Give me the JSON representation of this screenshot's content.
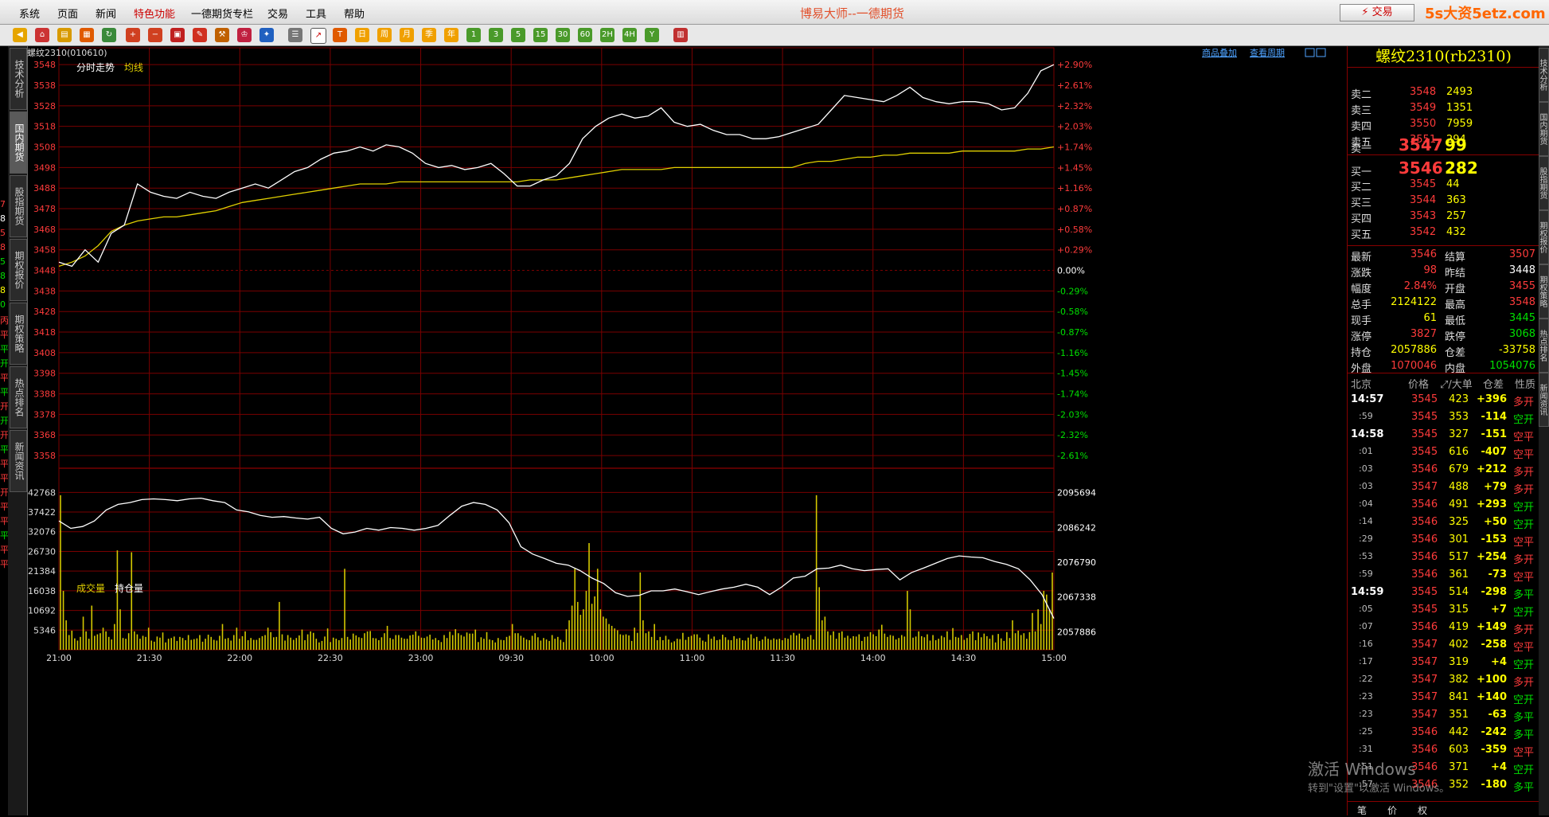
{
  "menu": [
    "系统",
    "页面",
    "新闻",
    "特色功能",
    "一德期货专栏",
    "交易",
    "工具",
    "帮助"
  ],
  "app_title": "博易大师--一德期货",
  "trade_button": "⚡ 交易",
  "site_logo": "5s大资5etz.com",
  "toolbar": {
    "period_buttons": [
      "日",
      "周",
      "月",
      "季",
      "年",
      "1",
      "3",
      "5",
      "15",
      "30",
      "60",
      "2H",
      "4H",
      "Y"
    ],
    "icons": [
      "back-icon",
      "home-icon",
      "book-icon",
      "news-icon",
      "zoom-in-icon",
      "zoom-out-icon",
      "window-icon",
      "pen-icon",
      "tool-icon",
      "trophy-icon",
      "new-icon",
      "table-icon",
      "trend-icon",
      "tick-icon",
      "calendar-icon"
    ]
  },
  "left_tabs": [
    "技术分析",
    "国内期货",
    "股指期货",
    "期权报价",
    "期权策略",
    "热点排名",
    "新闻资讯"
  ],
  "left_tabs_active": 1,
  "right_tabs": [
    "技术分析",
    "国内期货",
    "股指期货",
    "期权报价",
    "期权策略",
    "热点排名",
    "新闻资讯"
  ],
  "left_edge_marks": [
    {
      "text": "7",
      "c": "red"
    },
    {
      "text": "8",
      "c": "wht"
    },
    {
      "text": "5",
      "c": "red"
    },
    {
      "text": "8",
      "c": "red"
    },
    {
      "text": "5",
      "c": "grn"
    },
    {
      "text": "8",
      "c": "grn"
    },
    {
      "text": "8",
      "c": "yel"
    },
    {
      "text": "0",
      "c": "grn"
    },
    {
      "text": "丙",
      "c": "red"
    },
    {
      "text": "平",
      "c": "red"
    },
    {
      "text": "平",
      "c": "grn"
    },
    {
      "text": "开",
      "c": "grn"
    },
    {
      "text": "平",
      "c": "red"
    },
    {
      "text": "平",
      "c": "grn"
    },
    {
      "text": "开",
      "c": "red"
    },
    {
      "text": "开",
      "c": "grn"
    },
    {
      "text": "开",
      "c": "red"
    },
    {
      "text": "平",
      "c": "grn"
    },
    {
      "text": "平",
      "c": "red"
    },
    {
      "text": "平",
      "c": "red"
    },
    {
      "text": "开",
      "c": "red"
    },
    {
      "text": "平",
      "c": "red"
    },
    {
      "text": "平",
      "c": "red"
    },
    {
      "text": "平",
      "c": "grn"
    },
    {
      "text": "平",
      "c": "red"
    },
    {
      "text": "平",
      "c": "red"
    }
  ],
  "chart_header": {
    "symbol_code": "螺纹2310(010610)",
    "tab_intraday": "分时走势",
    "tab_avg": "均线",
    "link_overlay": "商品叠加",
    "link_period": "查看周期"
  },
  "chart_data": {
    "type": "line",
    "price_axis_labels": [
      "3548",
      "3538",
      "3528",
      "3518",
      "3508",
      "3498",
      "3488",
      "3478",
      "3468",
      "3458",
      "3448",
      "3438",
      "3428",
      "3418",
      "3408",
      "3398",
      "3388",
      "3378",
      "3368",
      "3358"
    ],
    "pct_axis_labels": [
      "+2.90%",
      "+2.61%",
      "+2.32%",
      "+2.03%",
      "+1.74%",
      "+1.45%",
      "+1.16%",
      "+0.87%",
      "+0.58%",
      "+0.29%",
      "0.00%",
      "-0.29%",
      "-0.58%",
      "-0.87%",
      "-1.16%",
      "-1.45%",
      "-1.74%",
      "-2.03%",
      "-2.32%",
      "-2.61%"
    ],
    "prev_settle": 3448,
    "ylim": [
      3353,
      3550
    ],
    "x_ticks": [
      "21:00",
      "21:30",
      "22:00",
      "22:30",
      "23:00",
      "09:30",
      "10:00",
      "11:00",
      "11:30",
      "14:00",
      "14:30",
      "15:00"
    ],
    "price_series": [
      3452,
      3450,
      3458,
      3452,
      3466,
      3470,
      3490,
      3486,
      3484,
      3483,
      3486,
      3484,
      3483,
      3486,
      3488,
      3490,
      3488,
      3492,
      3496,
      3498,
      3502,
      3505,
      3506,
      3508,
      3506,
      3509,
      3508,
      3505,
      3500,
      3498,
      3499,
      3497,
      3498,
      3500,
      3495,
      3489,
      3489,
      3492,
      3494,
      3500,
      3512,
      3518,
      3522,
      3524,
      3522,
      3523,
      3527,
      3520,
      3518,
      3519,
      3516,
      3514,
      3514,
      3512,
      3512,
      3513,
      3515,
      3517,
      3519,
      3526,
      3533,
      3532,
      3531,
      3530,
      3533,
      3537,
      3532,
      3530,
      3529,
      3530,
      3530,
      3529,
      3526,
      3527,
      3534,
      3545,
      3548
    ],
    "avg_series": [
      3450,
      3452,
      3455,
      3460,
      3467,
      3470,
      3472,
      3473,
      3474,
      3474,
      3475,
      3476,
      3477,
      3479,
      3481,
      3482,
      3483,
      3484,
      3485,
      3486,
      3487,
      3488,
      3489,
      3490,
      3490,
      3490,
      3491,
      3491,
      3491,
      3491,
      3491,
      3491,
      3491,
      3491,
      3491,
      3491,
      3492,
      3492,
      3492,
      3493,
      3494,
      3495,
      3496,
      3497,
      3497,
      3497,
      3497,
      3498,
      3498,
      3498,
      3498,
      3498,
      3498,
      3498,
      3498,
      3498,
      3498,
      3500,
      3501,
      3501,
      3502,
      3503,
      3503,
      3504,
      3504,
      3505,
      3505,
      3505,
      3505,
      3506,
      3506,
      3506,
      3506,
      3506,
      3507,
      3507,
      3508
    ],
    "volume_header": {
      "vol_label": "成交量",
      "oi_label": "持仓量"
    },
    "volume_axis_labels": [
      "42768",
      "37422",
      "32076",
      "26730",
      "21384",
      "16038",
      "10692",
      "5346"
    ],
    "oi_axis_labels": [
      "2095694",
      "2086242",
      "2076790",
      "2067338",
      "2057886"
    ],
    "vol_ylim": [
      0,
      45000
    ],
    "oi_ylim": [
      2053000,
      2098000
    ],
    "volume_bars": [
      42000,
      16000,
      8000,
      4000,
      5200,
      3100,
      2500,
      3500,
      9000,
      5000,
      3000,
      12000,
      3800,
      4200,
      4500,
      6000,
      5000,
      3500,
      2800,
      7000,
      27000,
      11000,
      3200,
      3000,
      4500,
      26500,
      5000,
      4200,
      3000,
      3800,
      3500,
      6000,
      2500,
      2200,
      3600,
      3300,
      4700,
      2000,
      3000,
      3200,
      3600,
      2400,
      3500,
      3200,
      2600,
      4000,
      2700,
      2900,
      3100,
      4000,
      2200,
      3000,
      4100,
      3500,
      2700,
      2500,
      3800,
      7000,
      3000,
      3200,
      2500,
      4000,
      6000,
      3000,
      3700,
      5000,
      2600,
      3200,
      2700,
      2700,
      3200,
      3700,
      4000,
      6000,
      4800,
      3400,
      3500,
      13000,
      4200,
      2500,
      4000,
      3300,
      2700,
      3200,
      3900,
      5500,
      2600,
      4200,
      5000,
      4600,
      3000,
      2000,
      2400,
      3600,
      5800,
      2100,
      3300,
      3000,
      2600,
      3200,
      22000,
      3500,
      2800,
      4400,
      3900,
      3400,
      3200,
      4500,
      5000,
      5100,
      3200,
      3100,
      2600,
      3400,
      4500,
      6500,
      3200,
      2900,
      4000,
      4000,
      3300,
      3000,
      3000,
      3900,
      4100,
      5000,
      3800,
      3300,
      3200,
      3600,
      4100,
      2800,
      3200,
      2600,
      2100,
      4000,
      3200,
      4900,
      4000,
      5600,
      4500,
      4000,
      3600,
      4700,
      4400,
      4400,
      5500,
      2100,
      3400,
      3000,
      4800,
      2800,
      2600,
      2000,
      3200,
      2700,
      2600,
      3500,
      3800,
      7000,
      4500,
      4500,
      3800,
      3300,
      2800,
      2600,
      3800,
      4500,
      3400,
      2500,
      3200,
      2800,
      2400,
      4000,
      3000,
      3500,
      2700,
      2100,
      5600,
      8000,
      12000,
      22000,
      13000,
      9500,
      11000,
      16000,
      29000,
      12500,
      14500,
      22000,
      11000,
      9000,
      8500,
      7000,
      6500,
      5800,
      5300,
      4200,
      4000,
      4200,
      3900,
      2400,
      6000,
      4600,
      21000,
      8000,
      4500,
      5000,
      3500,
      7000,
      2600,
      3500,
      2600,
      3800,
      2800,
      2000,
      2300,
      3000,
      2900,
      4600,
      2700,
      3500,
      3800,
      4200,
      4200,
      3300,
      2500,
      2200,
      4200,
      3000,
      3600,
      2600,
      2800,
      4100,
      3400,
      2700,
      2600,
      3700,
      3000,
      3200,
      2600,
      2500,
      3300,
      4200,
      3100,
      3500,
      2400,
      2800,
      3600,
      3000,
      2700,
      3100,
      2800,
      3000,
      2600,
      3200,
      3000,
      4000,
      4600,
      3900,
      4400,
      3100,
      2900,
      3500,
      4000,
      2800,
      42000,
      17000,
      8000,
      9000,
      5000,
      4000,
      5000,
      3000,
      4600,
      5000,
      3300,
      3800,
      3100,
      3700,
      3600,
      4200,
      2400,
      3500,
      3600,
      4800,
      4200,
      3700,
      5500,
      6800,
      4400,
      3500,
      4000,
      3800,
      2800,
      3200,
      4000,
      3600,
      16000,
      11000,
      3300,
      3600,
      5000,
      3700,
      3400,
      4200,
      2500,
      4000,
      2600,
      3000,
      3800,
      3400,
      5000,
      2700,
      5900,
      3500,
      3300,
      4000,
      2700,
      3200,
      4300,
      5000,
      2600,
      4700,
      3400,
      4400,
      3700,
      3000,
      4000,
      2000,
      4300,
      3100,
      2400,
      4800,
      3200,
      8000,
      4500,
      5200,
      4000,
      4500,
      3000,
      4800,
      10000,
      5000,
      11000,
      7000,
      16000,
      15000,
      11000,
      21000
    ],
    "oi_series": [
      2088000,
      2086000,
      2086500,
      2088000,
      2091000,
      2092500,
      2093000,
      2093800,
      2094000,
      2093800,
      2093500,
      2094000,
      2094200,
      2093500,
      2093000,
      2091000,
      2090500,
      2089500,
      2089000,
      2089200,
      2088800,
      2088500,
      2089000,
      2086000,
      2084500,
      2085000,
      2086000,
      2085500,
      2086200,
      2086000,
      2085500,
      2086000,
      2086800,
      2089500,
      2092000,
      2093000,
      2092500,
      2091000,
      2087500,
      2081000,
      2079000,
      2077800,
      2076500,
      2076000,
      2074500,
      2072500,
      2071000,
      2068500,
      2067500,
      2067800,
      2069000,
      2069000,
      2069500,
      2068800,
      2068000,
      2068800,
      2069500,
      2070000,
      2070800,
      2070000,
      2068000,
      2070000,
      2072500,
      2073000,
      2075000,
      2075200,
      2076000,
      2075000,
      2074500,
      2074800,
      2075000,
      2072000,
      2074000,
      2075200,
      2076500,
      2077800,
      2078500,
      2078200,
      2078000,
      2077000,
      2076200,
      2075000,
      2072000,
      2068000,
      2061500
    ],
    "dashed_price_line": 3448
  },
  "quote": {
    "title": "螺纹2310(rb2310)",
    "asks": [
      {
        "label": "卖五",
        "price": "3551",
        "vol": "294"
      },
      {
        "label": "卖四",
        "price": "3550",
        "vol": "7959"
      },
      {
        "label": "卖三",
        "price": "3549",
        "vol": "1351"
      },
      {
        "label": "卖二",
        "price": "3548",
        "vol": "2493"
      },
      {
        "label": "卖一",
        "price": "3547",
        "vol": "99"
      }
    ],
    "bids": [
      {
        "label": "买一",
        "price": "3546",
        "vol": "282"
      },
      {
        "label": "买二",
        "price": "3545",
        "vol": "44"
      },
      {
        "label": "买三",
        "price": "3544",
        "vol": "363"
      },
      {
        "label": "买四",
        "price": "3543",
        "vol": "257"
      },
      {
        "label": "买五",
        "price": "3542",
        "vol": "432"
      }
    ],
    "stats": [
      {
        "l1": "最新",
        "v1": "3546",
        "c1": "red",
        "l2": "结算",
        "v2": "3507",
        "c2": "red"
      },
      {
        "l1": "涨跌",
        "v1": "98",
        "c1": "red",
        "l2": "昨结",
        "v2": "3448",
        "c2": "wht"
      },
      {
        "l1": "幅度",
        "v1": "2.84%",
        "c1": "red",
        "l2": "开盘",
        "v2": "3455",
        "c2": "red"
      },
      {
        "l1": "总手",
        "v1": "2124122",
        "c1": "yel",
        "l2": "最高",
        "v2": "3548",
        "c2": "red"
      },
      {
        "l1": "现手",
        "v1": "61",
        "c1": "yel",
        "l2": "最低",
        "v2": "3445",
        "c2": "grn"
      },
      {
        "l1": "涨停",
        "v1": "3827",
        "c1": "red",
        "l2": "跌停",
        "v2": "3068",
        "c2": "grn"
      },
      {
        "l1": "持仓",
        "v1": "2057886",
        "c1": "yel",
        "l2": "仓差",
        "v2": "-33758",
        "c2": "yel"
      },
      {
        "l1": "外盘",
        "v1": "1070046",
        "c1": "red",
        "l2": "内盘",
        "v2": "1054076",
        "c2": "grn"
      }
    ],
    "ticks_header": {
      "time": "北京",
      "price": "价格",
      "vol": "⤢/大单",
      "oi": "仓差",
      "nature": "性质"
    },
    "ticks": [
      {
        "t": "14:57",
        "p": "3545",
        "v": "423",
        "oi": "+396",
        "n": "多开",
        "nc": "red",
        "big": true
      },
      {
        "t": ":59",
        "p": "3545",
        "v": "353",
        "oi": "-114",
        "n": "空开",
        "nc": "grn",
        "big": false
      },
      {
        "t": "14:58",
        "p": "3545",
        "v": "327",
        "oi": "-151",
        "n": "空平",
        "nc": "red",
        "big": true
      },
      {
        "t": ":01",
        "p": "3545",
        "v": "616",
        "oi": "-407",
        "n": "空平",
        "nc": "red",
        "big": false
      },
      {
        "t": ":03",
        "p": "3546",
        "v": "679",
        "oi": "+212",
        "n": "多开",
        "nc": "red",
        "big": false
      },
      {
        "t": ":03",
        "p": "3547",
        "v": "488",
        "oi": "+79",
        "n": "多开",
        "nc": "red",
        "big": false
      },
      {
        "t": ":04",
        "p": "3546",
        "v": "491",
        "oi": "+293",
        "n": "空开",
        "nc": "grn",
        "big": false
      },
      {
        "t": ":14",
        "p": "3546",
        "v": "325",
        "oi": "+50",
        "n": "空开",
        "nc": "grn",
        "big": false
      },
      {
        "t": ":29",
        "p": "3546",
        "v": "301",
        "oi": "-153",
        "n": "空平",
        "nc": "red",
        "big": false
      },
      {
        "t": ":53",
        "p": "3546",
        "v": "517",
        "oi": "+254",
        "n": "多开",
        "nc": "red",
        "big": false
      },
      {
        "t": ":59",
        "p": "3546",
        "v": "361",
        "oi": "-73",
        "n": "空平",
        "nc": "red",
        "big": false
      },
      {
        "t": "14:59",
        "p": "3545",
        "v": "514",
        "oi": "-298",
        "n": "多平",
        "nc": "grn",
        "big": true
      },
      {
        "t": ":05",
        "p": "3545",
        "v": "315",
        "oi": "+7",
        "n": "空开",
        "nc": "grn",
        "big": false
      },
      {
        "t": ":07",
        "p": "3546",
        "v": "419",
        "oi": "+149",
        "n": "多开",
        "nc": "red",
        "big": false
      },
      {
        "t": ":16",
        "p": "3547",
        "v": "402",
        "oi": "-258",
        "n": "空平",
        "nc": "red",
        "big": false
      },
      {
        "t": ":17",
        "p": "3547",
        "v": "319",
        "oi": "+4",
        "n": "空开",
        "nc": "grn",
        "big": false
      },
      {
        "t": ":22",
        "p": "3547",
        "v": "382",
        "oi": "+100",
        "n": "多开",
        "nc": "red",
        "big": false
      },
      {
        "t": ":23",
        "p": "3547",
        "v": "841",
        "oi": "+140",
        "n": "空开",
        "nc": "grn",
        "big": false
      },
      {
        "t": ":23",
        "p": "3547",
        "v": "351",
        "oi": "-63",
        "n": "多平",
        "nc": "grn",
        "big": false
      },
      {
        "t": ":25",
        "p": "3546",
        "v": "442",
        "oi": "-242",
        "n": "多平",
        "nc": "grn",
        "big": false
      },
      {
        "t": ":31",
        "p": "3546",
        "v": "603",
        "oi": "-359",
        "n": "空平",
        "nc": "red",
        "big": false
      },
      {
        "t": ":51",
        "p": "3546",
        "v": "371",
        "oi": "+4",
        "n": "空开",
        "nc": "grn",
        "big": false
      },
      {
        "t": ":57",
        "p": "3546",
        "v": "352",
        "oi": "-180",
        "n": "多平",
        "nc": "grn",
        "big": false
      }
    ],
    "bottom_tabs": [
      "笔",
      "价",
      "权"
    ]
  },
  "os_watermark": {
    "line1": "激活 Windows",
    "line2": "转到\"设置\"以激活 Windows。"
  },
  "colors": {
    "up": "#ff3b3b",
    "down": "#00e000",
    "grid": "#7a0000",
    "price_line": "#ffffff",
    "avg_line": "#e0d000",
    "volume": "#d4c800"
  }
}
